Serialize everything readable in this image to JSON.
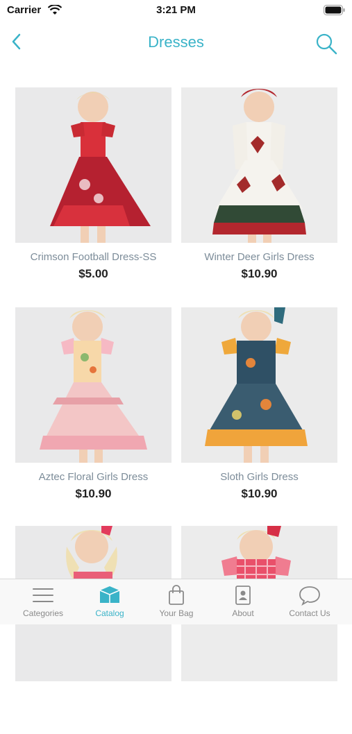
{
  "status_bar": {
    "carrier": "Carrier",
    "time": "3:21 PM"
  },
  "nav": {
    "title": "Dresses",
    "back_icon": "chevron-left-icon",
    "search_icon": "search-icon"
  },
  "colors": {
    "accent": "#3ab3c8",
    "tab_inactive": "#8a8a8a",
    "name_text": "#7c8c99"
  },
  "products": [
    {
      "name": "Crimson Football Dress-SS",
      "price": "$5.00"
    },
    {
      "name": "Winter Deer Girls Dress",
      "price": "$10.90"
    },
    {
      "name": "Aztec Floral Girls Dress",
      "price": "$10.90"
    },
    {
      "name": "Sloth Girls Dress",
      "price": "$10.90"
    },
    {
      "name": "",
      "price": ""
    },
    {
      "name": "",
      "price": ""
    }
  ],
  "tabs": [
    {
      "label": "Categories",
      "icon": "menu-icon",
      "active": false
    },
    {
      "label": "Catalog",
      "icon": "box-icon",
      "active": true
    },
    {
      "label": "Your Bag",
      "icon": "bag-icon",
      "active": false
    },
    {
      "label": "About",
      "icon": "contact-card-icon",
      "active": false
    },
    {
      "label": "Contact Us",
      "icon": "chat-bubble-icon",
      "active": false
    }
  ]
}
